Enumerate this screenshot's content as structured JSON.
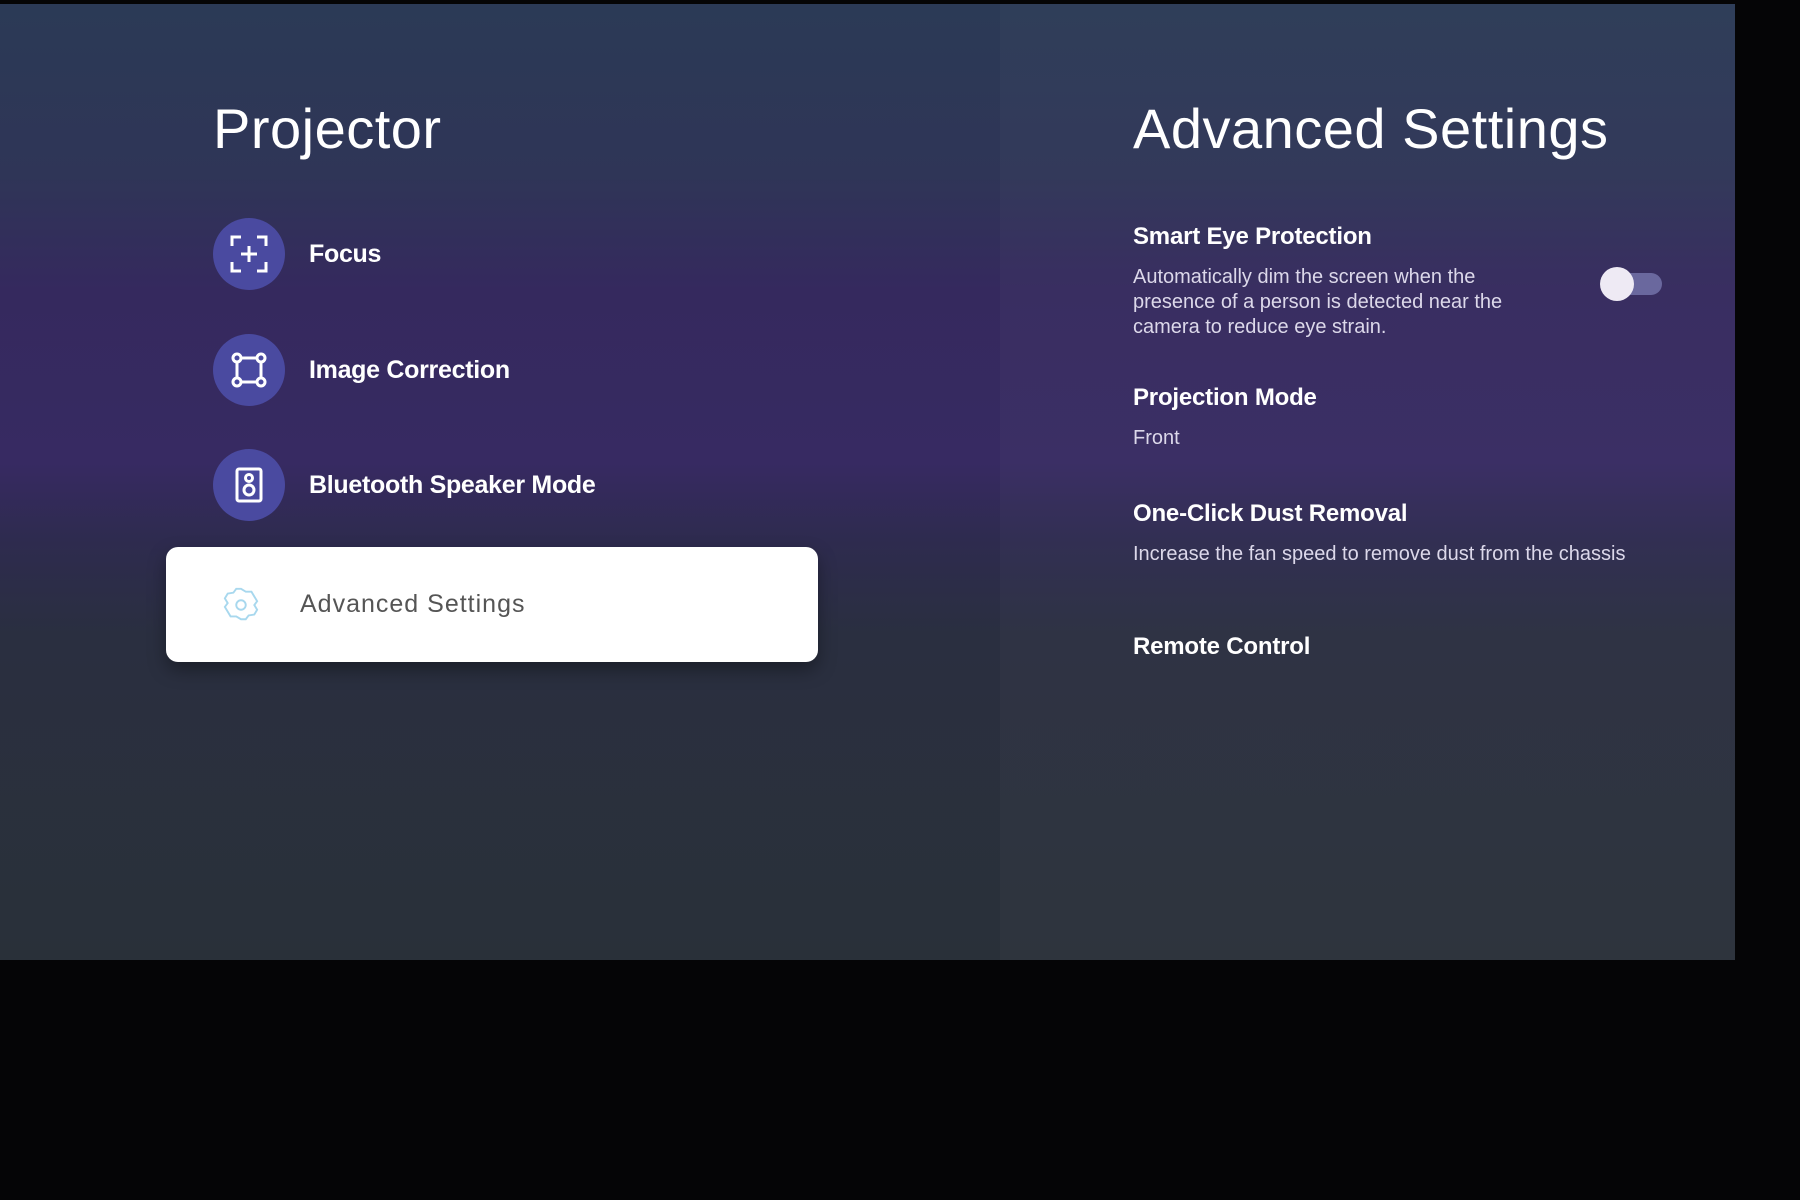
{
  "left": {
    "title": "Projector",
    "items": [
      {
        "label": "Focus",
        "icon": "focus-icon"
      },
      {
        "label": "Image Correction",
        "icon": "image-correction-icon"
      },
      {
        "label": "Bluetooth Speaker Mode",
        "icon": "speaker-icon"
      }
    ],
    "selected": {
      "label": "Advanced Settings",
      "icon": "gear-icon"
    }
  },
  "right": {
    "title": "Advanced Settings",
    "smart_eye": {
      "title": "Smart Eye Protection",
      "desc": [
        "Automatically dim the screen when the",
        "presence of a person is detected near the",
        "camera to reduce eye strain."
      ],
      "enabled": false
    },
    "projection": {
      "title": "Projection Mode",
      "value": "Front"
    },
    "dust": {
      "title": "One-Click Dust Removal",
      "desc": "Increase the fan speed to remove dust from the chassis"
    },
    "remote": {
      "title": "Remote Control"
    }
  },
  "colors": {
    "accent": "#4a4aa0",
    "card": "#ffffff"
  }
}
